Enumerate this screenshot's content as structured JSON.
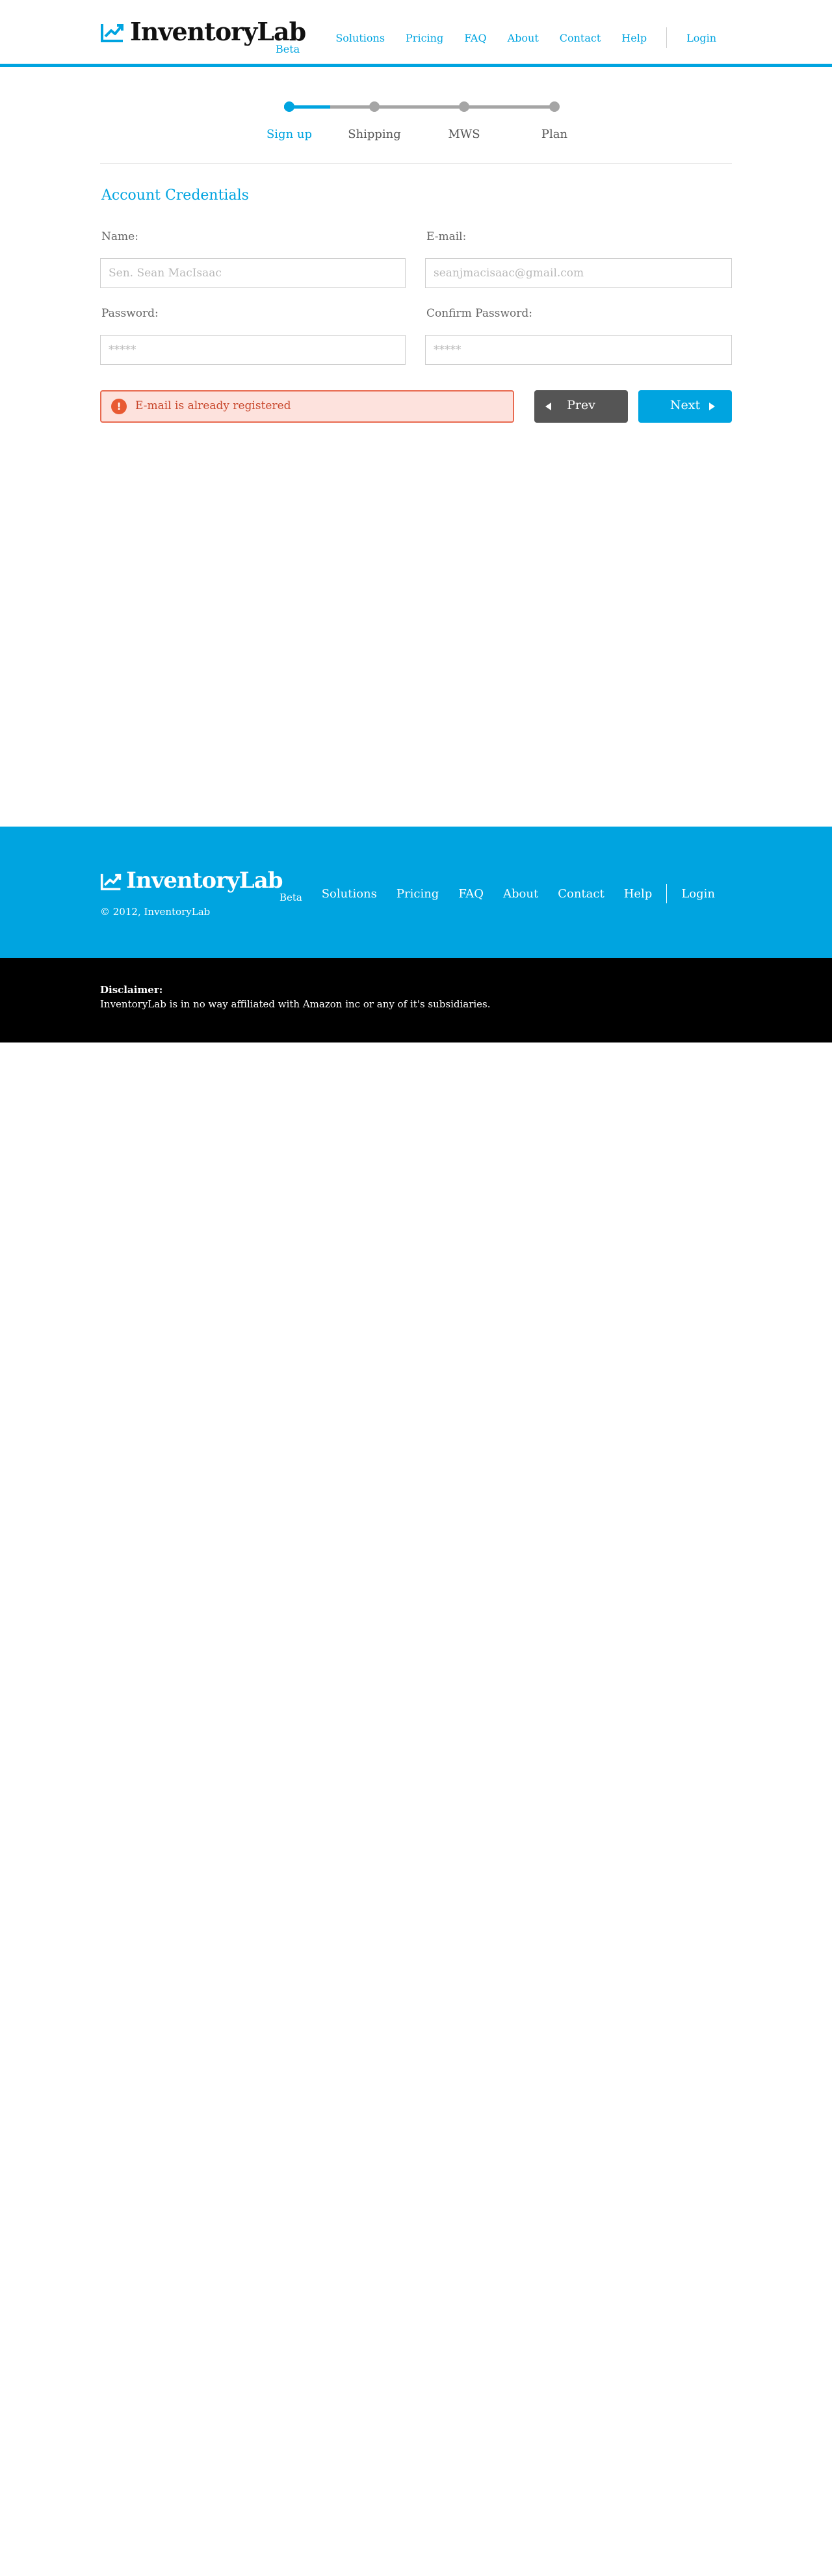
{
  "header": {
    "brand": "InventoryLab",
    "beta": "Beta",
    "nav": [
      "Solutions",
      "Pricing",
      "FAQ",
      "About",
      "Contact",
      "Help",
      "Login"
    ]
  },
  "stepper": {
    "steps": [
      {
        "label": "Sign up",
        "active": true
      },
      {
        "label": "Shipping",
        "active": false
      },
      {
        "label": "MWS",
        "active": false
      },
      {
        "label": "Plan",
        "active": false
      }
    ],
    "progress": 0.17
  },
  "form": {
    "title": "Account Credentials",
    "name_label": "Name:",
    "name_placeholder": "Sen. Sean MacIsaac",
    "email_label": "E-mail:",
    "email_placeholder": "seanjmacisaac@gmail.com",
    "password_label": "Password:",
    "password_placeholder": "*****",
    "confirm_label": "Confirm Password:",
    "confirm_placeholder": "*****",
    "error_icon": "!",
    "error_message": "E-mail is already registered",
    "prev_label": "Prev",
    "next_label": "Next"
  },
  "footer": {
    "brand": "InventoryLab",
    "beta": "Beta",
    "copyright": "© 2012, InventoryLab",
    "nav": [
      "Solutions",
      "Pricing",
      "FAQ",
      "About",
      "Contact",
      "Help",
      "Login"
    ]
  },
  "disclaimer": {
    "title": "Disclaimer:",
    "text": "InventoryLab is in no way affiliated with Amazon inc or any of it's subsidiaries."
  },
  "colors": {
    "accent": "#00a4e0",
    "error_border": "#e8694f",
    "error_bg": "#fde2dd",
    "dark_button": "#555555",
    "footer_bottom": "#000000"
  }
}
